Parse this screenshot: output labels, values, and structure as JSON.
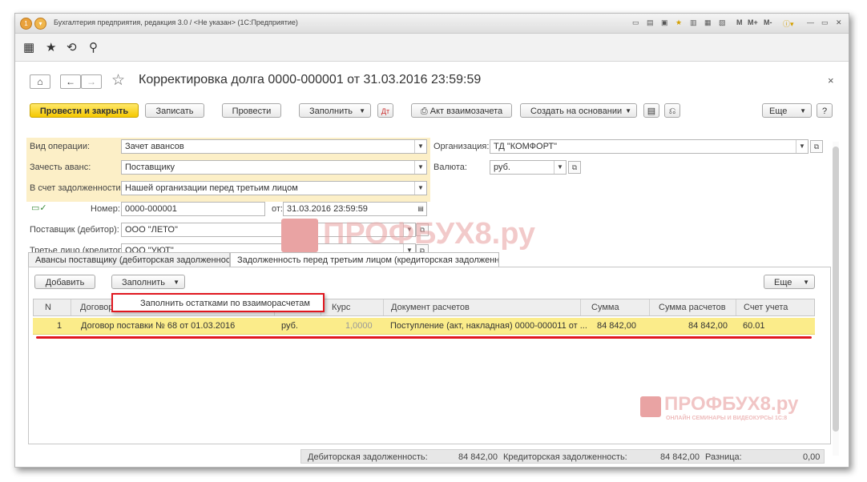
{
  "window": {
    "title": "Бухгалтерия предприятия, редакция 3.0 / <Не указан> (1С:Предприятие)",
    "memory_buttons": [
      "M",
      "M+",
      "M-"
    ]
  },
  "document": {
    "title": "Корректировка долга 0000-000001 от 31.03.2016 23:59:59",
    "toolbar": {
      "post_close": "Провести и закрыть",
      "write": "Записать",
      "post": "Провести",
      "fill": "Заполнить",
      "act": "Акт взаимозачета",
      "create_based": "Создать на основании",
      "more": "Еще",
      "help": "?"
    },
    "fields": {
      "operation_label": "Вид операции:",
      "operation_value": "Зачет авансов",
      "offset_label": "Зачесть аванс:",
      "offset_value": "Поставщику",
      "debt_label": "В счет задолженности:",
      "debt_value": "Нашей организации перед третьим лицом",
      "org_label": "Организация:",
      "org_value": "ТД \"КОМФОРТ\"",
      "currency_label": "Валюта:",
      "currency_value": "руб.",
      "number_label": "Номер:",
      "number_value": "0000-000001",
      "date_label": "от:",
      "date_value": "31.03.2016 23:59:59",
      "supplier_label": "Поставщик (дебитор):",
      "supplier_value": "ООО \"ЛЕТО\"",
      "third_label": "Третье лицо (кредитор):",
      "third_value": "ООО \"УЮТ\""
    },
    "tabs": [
      "Авансы поставщику (дебиторская задолженность)",
      "Задолженность перед третьим лицом (кредиторская задолженность)"
    ],
    "table_toolbar": {
      "add": "Добавить",
      "fill": "Заполнить",
      "more": "Еще",
      "menu_item": "Заполнить остатками по взаиморасчетам"
    },
    "columns": [
      "N",
      "Договор",
      "Курс",
      "Документ расчетов",
      "Сумма",
      "Сумма расчетов",
      "Счет учета"
    ],
    "rows": [
      {
        "n": "1",
        "contract": "Договор поставки № 68 от 01.03.2016",
        "currency": "руб.",
        "rate": "1,0000",
        "document": "Поступление (акт, накладная) 0000-000011 от ...",
        "sum": "84 842,00",
        "settlement_sum": "84 842,00",
        "account": "60.01"
      }
    ],
    "footer": {
      "debit_label": "Дебиторская задолженность:",
      "debit_value": "84 842,00",
      "credit_label": "Кредиторская задолженность:",
      "credit_value": "84 842,00",
      "diff_label": "Разница:",
      "diff_value": "0,00"
    }
  },
  "watermark": {
    "text": "ПРОФБУХ8.ру",
    "subtitle": "ОНЛАЙН СЕМИНАРЫ И ВИДЕОКУРСЫ 1С:8"
  },
  "colors": {
    "primary_button": "#f5c800",
    "highlight_row": "#fbec8a",
    "required_fields_bg": "#fcefc7",
    "annotation_red": "#e0171f"
  }
}
